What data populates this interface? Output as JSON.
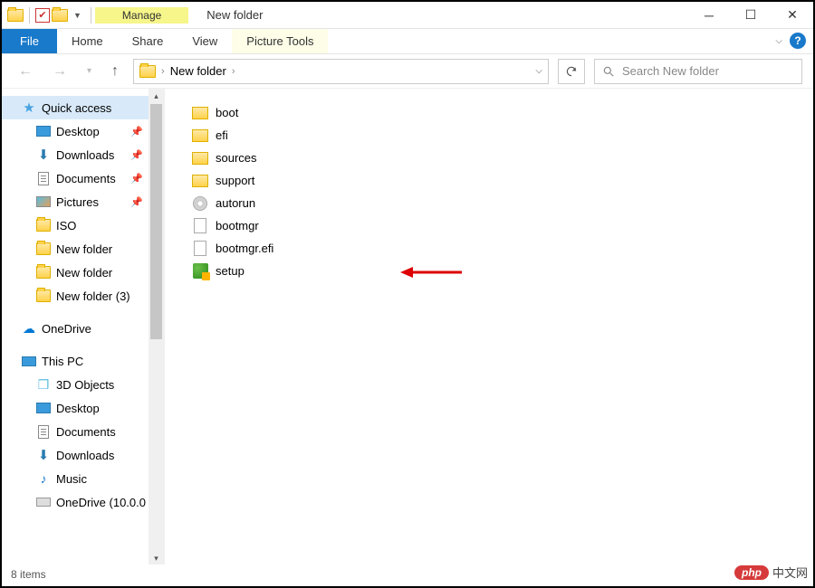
{
  "window": {
    "title": "New folder",
    "context_tab_header": "Manage",
    "context_tab_tool": "Picture Tools"
  },
  "ribbon": {
    "file": "File",
    "tabs": [
      "Home",
      "Share",
      "View"
    ]
  },
  "address": {
    "crumbs": [
      "New folder"
    ],
    "search_placeholder": "Search New folder"
  },
  "sidebar": {
    "quick_access": "Quick access",
    "qa_items": [
      {
        "label": "Desktop",
        "pinned": true,
        "icon": "desktop"
      },
      {
        "label": "Downloads",
        "pinned": true,
        "icon": "download"
      },
      {
        "label": "Documents",
        "pinned": true,
        "icon": "document"
      },
      {
        "label": "Pictures",
        "pinned": true,
        "icon": "picture"
      },
      {
        "label": "ISO",
        "pinned": false,
        "icon": "folder"
      },
      {
        "label": "New folder",
        "pinned": false,
        "icon": "folder"
      },
      {
        "label": "New folder",
        "pinned": false,
        "icon": "folder"
      },
      {
        "label": "New folder (3)",
        "pinned": false,
        "icon": "folder"
      }
    ],
    "onedrive": "OneDrive",
    "this_pc": "This PC",
    "pc_items": [
      {
        "label": "3D Objects",
        "icon": "cube"
      },
      {
        "label": "Desktop",
        "icon": "desktop"
      },
      {
        "label": "Documents",
        "icon": "document"
      },
      {
        "label": "Downloads",
        "icon": "download"
      },
      {
        "label": "Music",
        "icon": "music"
      },
      {
        "label": "OneDrive (10.0.0",
        "icon": "drive"
      }
    ]
  },
  "files": [
    {
      "name": "boot",
      "type": "folder"
    },
    {
      "name": "efi",
      "type": "folder"
    },
    {
      "name": "sources",
      "type": "folder"
    },
    {
      "name": "support",
      "type": "folder"
    },
    {
      "name": "autorun",
      "type": "disc"
    },
    {
      "name": "bootmgr",
      "type": "file"
    },
    {
      "name": "bootmgr.efi",
      "type": "file"
    },
    {
      "name": "setup",
      "type": "setup"
    }
  ],
  "status": "8 items",
  "watermark": {
    "logo": "php",
    "text": "中文网"
  }
}
